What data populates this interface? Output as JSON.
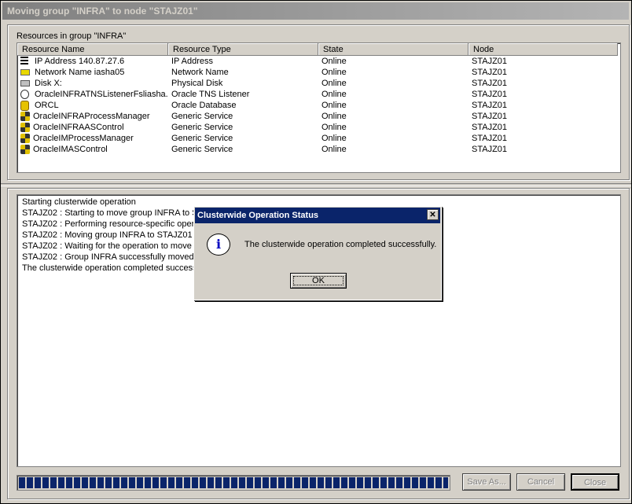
{
  "window": {
    "title": "Moving group \"INFRA\" to node \"STAJZ01\""
  },
  "resources": {
    "label": "Resources in group \"INFRA\"",
    "columns": [
      "Resource Name",
      "Resource Type",
      "State",
      "Node"
    ],
    "rows": [
      {
        "icon": "network-icon",
        "name": "IP Address 140.87.27.6",
        "type": "IP Address",
        "state": "Online",
        "node": "STAJZ01"
      },
      {
        "icon": "name-tag-icon",
        "name": "Network Name iasha05",
        "type": "Network Name",
        "state": "Online",
        "node": "STAJZ01"
      },
      {
        "icon": "disk-icon",
        "name": "Disk X:",
        "type": "Physical Disk",
        "state": "Online",
        "node": "STAJZ01"
      },
      {
        "icon": "listener-icon",
        "name": "OracleINFRATNSListenerFsliasha...",
        "type": "Oracle TNS Listener",
        "state": "Online",
        "node": "STAJZ01"
      },
      {
        "icon": "database-icon",
        "name": "ORCL",
        "type": "Oracle Database",
        "state": "Online",
        "node": "STAJZ01"
      },
      {
        "icon": "service-icon",
        "name": "OracleINFRAProcessManager",
        "type": "Generic Service",
        "state": "Online",
        "node": "STAJZ01"
      },
      {
        "icon": "service-icon",
        "name": "OracleINFRAASControl",
        "type": "Generic Service",
        "state": "Online",
        "node": "STAJZ01"
      },
      {
        "icon": "service-icon",
        "name": "OracleIMProcessManager",
        "type": "Generic Service",
        "state": "Online",
        "node": "STAJZ01"
      },
      {
        "icon": "service-icon",
        "name": "OracleIMASControl",
        "type": "Generic Service",
        "state": "Online",
        "node": "STAJZ01"
      }
    ]
  },
  "log": {
    "lines": [
      "Starting clusterwide operation",
      "STAJZ02 : Starting to move group INFRA to S",
      "STAJZ02 : Performing resource-specific operat",
      "STAJZ02 : Moving group INFRA to STAJZ01",
      "STAJZ02 : Waiting for the operation to move g",
      "STAJZ02 : Group INFRA successfully moved t",
      "The clusterwide operation completed successf"
    ]
  },
  "progress": {
    "value": 1.0
  },
  "buttons": {
    "save_as": "Save As...",
    "cancel": "Cancel",
    "close": "Close"
  },
  "dialog": {
    "title": "Clusterwide Operation Status",
    "close_glyph": "✕",
    "icon_glyph": "i",
    "message": "The clusterwide operation completed successfully.",
    "ok": "OK"
  }
}
